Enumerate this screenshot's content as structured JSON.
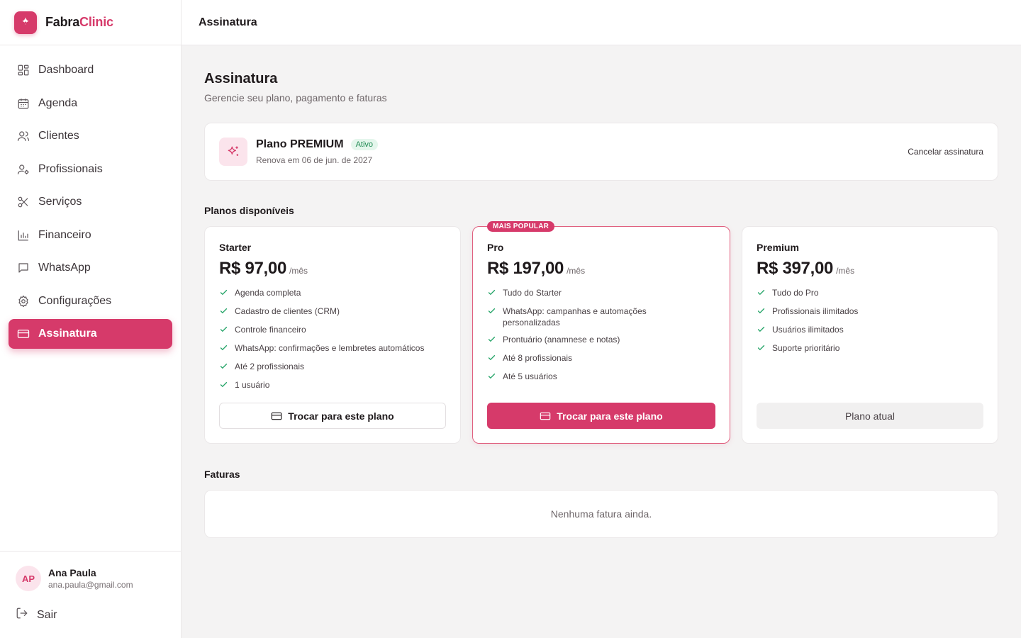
{
  "brand": {
    "part1": "Fabra",
    "part2": "Clinic",
    "accent": "#d63a6a"
  },
  "sidebar": {
    "items": [
      {
        "label": "Dashboard",
        "icon": "dashboard-icon"
      },
      {
        "label": "Agenda",
        "icon": "calendar-icon"
      },
      {
        "label": "Clientes",
        "icon": "users-icon"
      },
      {
        "label": "Profissionais",
        "icon": "user-gear-icon"
      },
      {
        "label": "Serviços",
        "icon": "scissors-icon"
      },
      {
        "label": "Financeiro",
        "icon": "bar-chart-icon"
      },
      {
        "label": "WhatsApp",
        "icon": "message-icon"
      },
      {
        "label": "Configurações",
        "icon": "gear-icon"
      },
      {
        "label": "Assinatura",
        "icon": "credit-card-icon",
        "active": true
      }
    ]
  },
  "user": {
    "initials": "AP",
    "name": "Ana Paula",
    "email": "ana.paula@gmail.com",
    "logout": "Sair"
  },
  "topbar": {
    "title": "Assinatura"
  },
  "page": {
    "title": "Assinatura",
    "subtitle": "Gerencie seu plano, pagamento e faturas"
  },
  "current_plan": {
    "title": "Plano PREMIUM",
    "status": "Ativo",
    "renewal": "Renova em 06 de jun. de 2027",
    "cancel": "Cancelar assinatura"
  },
  "plans_section": "Planos disponíveis",
  "plans": [
    {
      "name": "Starter",
      "price": "R$ 97,00",
      "period": "/mês",
      "features": [
        "Agenda completa",
        "Cadastro de clientes (CRM)",
        "Controle financeiro",
        "WhatsApp: confirmações e lembretes automáticos",
        "Até 2 profissionais",
        "1 usuário"
      ],
      "button": "Trocar para este plano"
    },
    {
      "name": "Pro",
      "price": "R$ 197,00",
      "period": "/mês",
      "tag": "MAIS POPULAR",
      "features": [
        "Tudo do Starter",
        "WhatsApp: campanhas e automações personalizadas",
        "Prontuário (anamnese e notas)",
        "Até 8 profissionais",
        "Até 5 usuários"
      ],
      "button": "Trocar para este plano"
    },
    {
      "name": "Premium",
      "price": "R$ 397,00",
      "period": "/mês",
      "features": [
        "Tudo do Pro",
        "Profissionais ilimitados",
        "Usuários ilimitados",
        "Suporte prioritário"
      ],
      "button": "Plano atual"
    }
  ],
  "invoices": {
    "title": "Faturas",
    "empty": "Nenhuma fatura ainda."
  }
}
